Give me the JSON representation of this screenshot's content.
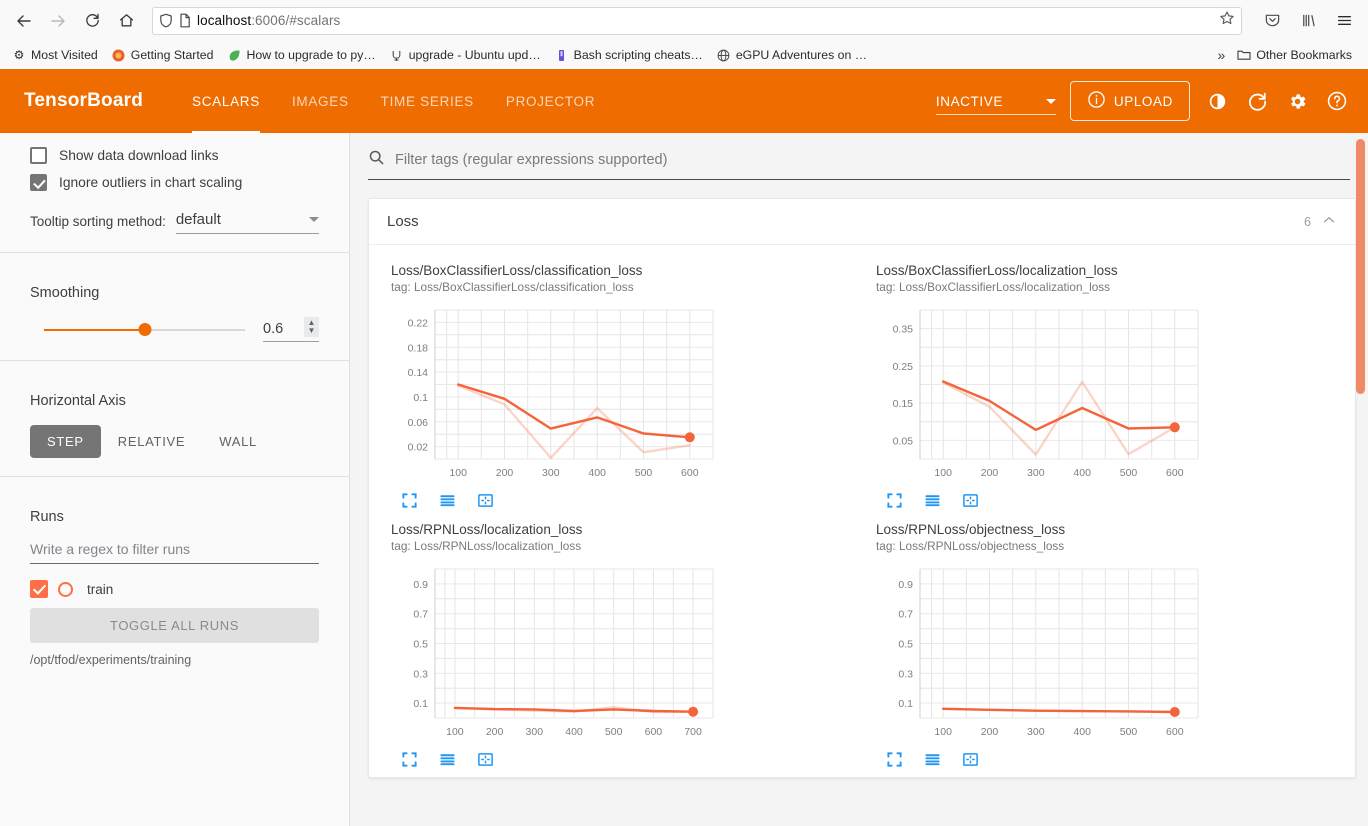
{
  "browser": {
    "nav": {
      "back_icon": "back-arrow-icon",
      "forward_icon": "forward-arrow-icon",
      "reload_icon": "reload-icon",
      "home_icon": "home-icon"
    },
    "url": {
      "host": "localhost",
      "rest": ":6006/#scalars",
      "full": "localhost:6006/#scalars"
    },
    "bookmarks": [
      {
        "label": "Most Visited",
        "icon": "gear-icon"
      },
      {
        "label": "Getting Started",
        "icon": "firefox-icon"
      },
      {
        "label": "How to upgrade to py…",
        "icon": "leaf-icon"
      },
      {
        "label": "upgrade - Ubuntu upd…",
        "icon": "ubuntu-icon"
      },
      {
        "label": "Bash scripting cheats…",
        "icon": "book-icon"
      },
      {
        "label": "eGPU Adventures on …",
        "icon": "globe-icon"
      }
    ],
    "other_bookmarks": "Other Bookmarks",
    "overflow_icon": "chevron-double-right-icon"
  },
  "tensorboard": {
    "logo": "TensorBoard",
    "tabs": [
      {
        "label": "SCALARS",
        "active": true
      },
      {
        "label": "IMAGES",
        "active": false
      },
      {
        "label": "TIME SERIES",
        "active": false
      },
      {
        "label": "PROJECTOR",
        "active": false
      }
    ],
    "status_select": "INACTIVE",
    "upload_label": "UPLOAD",
    "header_icons": [
      "brightness-icon",
      "refresh-icon",
      "gear-icon",
      "help-icon"
    ],
    "accent_color": "#ef6c00"
  },
  "sidebar": {
    "show_download_links": {
      "label": "Show data download links",
      "checked": false
    },
    "ignore_outliers": {
      "label": "Ignore outliers in chart scaling",
      "checked": true
    },
    "tooltip_sorting": {
      "label": "Tooltip sorting method:",
      "value": "default"
    },
    "smoothing": {
      "title": "Smoothing",
      "value": "0.6",
      "position_pct": 50
    },
    "horizontal_axis": {
      "title": "Horizontal Axis",
      "options": [
        {
          "label": "STEP",
          "active": true
        },
        {
          "label": "RELATIVE",
          "active": false
        },
        {
          "label": "WALL",
          "active": false
        }
      ]
    },
    "runs": {
      "title": "Runs",
      "filter_placeholder": "Write a regex to filter runs",
      "items": [
        {
          "name": "train",
          "checked": true,
          "color": "#ff6f47"
        }
      ],
      "toggle_all_label": "TOGGLE ALL RUNS",
      "path": "/opt/tfod/experiments/training"
    }
  },
  "main": {
    "filter_placeholder": "Filter tags (regular expressions supported)",
    "search_icon": "search-icon",
    "card": {
      "title": "Loss",
      "count": "6",
      "collapse_icon": "chevron-up-icon"
    },
    "chart_action_icons": [
      "expand-chart-icon",
      "data-series-icon",
      "fit-domain-icon"
    ]
  },
  "chart_data": [
    {
      "type": "line",
      "title": "Loss/BoxClassifierLoss/classification_loss",
      "tag": "tag: Loss/BoxClassifierLoss/classification_loss",
      "xlabel": "",
      "ylabel": "",
      "xticks": [
        100,
        200,
        300,
        400,
        500,
        600
      ],
      "yticks": [
        0.02,
        0.06,
        0.1,
        0.14,
        0.18,
        0.22
      ],
      "xlim": [
        50,
        650
      ],
      "ylim": [
        0.0,
        0.24
      ],
      "grid": true,
      "legend": [
        "train"
      ],
      "series": [
        {
          "name": "train-smoothed",
          "color": "#f4643b",
          "opacity": 1,
          "x": [
            100,
            200,
            300,
            400,
            500,
            600
          ],
          "values": [
            0.12,
            0.097,
            0.049,
            0.067,
            0.041,
            0.035
          ]
        },
        {
          "name": "train-raw",
          "color": "#f4643b",
          "opacity": 0.28,
          "x": [
            100,
            200,
            300,
            400,
            500,
            600
          ],
          "values": [
            0.118,
            0.088,
            0.002,
            0.082,
            0.011,
            0.022
          ]
        }
      ],
      "last_point": {
        "x": 600,
        "y": 0.035
      }
    },
    {
      "type": "line",
      "title": "Loss/BoxClassifierLoss/localization_loss",
      "tag": "tag: Loss/BoxClassifierLoss/localization_loss",
      "xlabel": "",
      "ylabel": "",
      "xticks": [
        100,
        200,
        300,
        400,
        500,
        600
      ],
      "yticks": [
        0.05,
        0.15,
        0.25,
        0.35
      ],
      "xlim": [
        50,
        650
      ],
      "ylim": [
        0.0,
        0.4
      ],
      "grid": true,
      "legend": [
        "train"
      ],
      "series": [
        {
          "name": "train-smoothed",
          "color": "#f4643b",
          "opacity": 1,
          "x": [
            100,
            200,
            300,
            400,
            500,
            600
          ],
          "values": [
            0.208,
            0.156,
            0.078,
            0.137,
            0.082,
            0.085
          ]
        },
        {
          "name": "train-raw",
          "color": "#f4643b",
          "opacity": 0.28,
          "x": [
            100,
            200,
            300,
            400,
            500,
            600
          ],
          "values": [
            0.205,
            0.14,
            0.012,
            0.207,
            0.013,
            0.085
          ]
        }
      ],
      "last_point": {
        "x": 600,
        "y": 0.085
      }
    },
    {
      "type": "line",
      "title": "Loss/RPNLoss/localization_loss",
      "tag": "tag: Loss/RPNLoss/localization_loss",
      "xlabel": "",
      "ylabel": "",
      "xticks": [
        100,
        200,
        300,
        400,
        500,
        600,
        700
      ],
      "yticks": [
        0.1,
        0.3,
        0.5,
        0.7,
        0.9
      ],
      "xlim": [
        50,
        750
      ],
      "ylim": [
        0.0,
        1.0
      ],
      "grid": true,
      "legend": [
        "train"
      ],
      "series": [
        {
          "name": "train-smoothed",
          "color": "#f4643b",
          "opacity": 1,
          "x": [
            100,
            200,
            300,
            400,
            500,
            600,
            700
          ],
          "values": [
            0.068,
            0.06,
            0.058,
            0.047,
            0.058,
            0.047,
            0.042
          ]
        },
        {
          "name": "train-raw",
          "color": "#f4643b",
          "opacity": 0.28,
          "x": [
            100,
            200,
            300,
            400,
            500,
            600,
            700
          ],
          "values": [
            0.068,
            0.058,
            0.05,
            0.043,
            0.072,
            0.04,
            0.042
          ]
        }
      ],
      "last_point": {
        "x": 700,
        "y": 0.042
      }
    },
    {
      "type": "line",
      "title": "Loss/RPNLoss/objectness_loss",
      "tag": "tag: Loss/RPNLoss/objectness_loss",
      "xlabel": "",
      "ylabel": "",
      "xticks": [
        100,
        200,
        300,
        400,
        500,
        600
      ],
      "yticks": [
        0.1,
        0.3,
        0.5,
        0.7,
        0.9
      ],
      "xlim": [
        50,
        650
      ],
      "ylim": [
        0.0,
        1.0
      ],
      "grid": true,
      "legend": [
        "train"
      ],
      "series": [
        {
          "name": "train-smoothed",
          "color": "#f4643b",
          "opacity": 1,
          "x": [
            100,
            200,
            300,
            400,
            500,
            600
          ],
          "values": [
            0.062,
            0.055,
            0.049,
            0.046,
            0.044,
            0.04
          ]
        },
        {
          "name": "train-raw",
          "color": "#f4643b",
          "opacity": 0.28,
          "x": [
            100,
            200,
            300,
            400,
            500,
            600
          ],
          "values": [
            0.062,
            0.055,
            0.049,
            0.046,
            0.044,
            0.04
          ]
        }
      ],
      "last_point": {
        "x": 600,
        "y": 0.04
      }
    }
  ]
}
